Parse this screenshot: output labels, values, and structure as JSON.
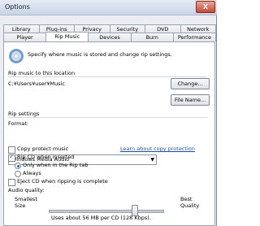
{
  "window": {
    "title": "Options",
    "close_label": "X"
  },
  "tabs": {
    "row1": [
      "Library",
      "Plug-ins",
      "Privacy",
      "Security",
      "DVD",
      "Network"
    ],
    "row2": [
      "Player",
      "Rip Music",
      "Devices",
      "Burn",
      "Performance"
    ],
    "active": "Rip Music"
  },
  "intro": "Specify where music is stored and change rip settings.",
  "location": {
    "heading": "Rip music to this location",
    "path": "C:¥Users¥user¥Music",
    "change_label": "Change...",
    "filename_label": "File Name..."
  },
  "settings": {
    "heading": "Rip settings",
    "format_label": "Format:",
    "format_value": "Windows Media Audio",
    "copy_protect_label": "Copy protect music",
    "copy_protect_checked": false,
    "learn_link": "Learn about copy protection",
    "rip_cd_label": "Rip CD when inserted",
    "rip_cd_checked": true,
    "radio_only_label": "Only when in the Rip tab",
    "radio_always_label": "Always",
    "eject_label": "Eject CD when ripping is complete",
    "eject_checked": false
  },
  "quality": {
    "heading": "Audio quality:",
    "smallest_line1": "Smallest",
    "smallest_line2": "Size",
    "best_line1": "Best",
    "best_line2": "Quality",
    "level": 0.75,
    "usage": "Uses about 56 MB per CD (128 Kbps)."
  }
}
